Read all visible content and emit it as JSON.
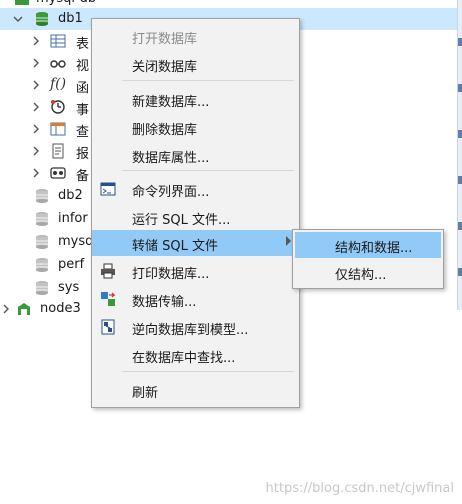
{
  "tree": {
    "top_label": "mysql-db",
    "db1": "db1",
    "children": [
      "表",
      "视",
      "函",
      "事",
      "查",
      "报",
      "备"
    ],
    "siblings": [
      "db2",
      "infor",
      "mysq",
      "perf",
      "sys"
    ],
    "node3": "node3"
  },
  "menu": {
    "items": {
      "open_db": "打开数据库",
      "close_db": "关闭数据库",
      "new_db": "新建数据库...",
      "delete_db": "删除数据库",
      "db_props": "数据库属性...",
      "cmd_console": "命令列界面...",
      "run_sql": "运行 SQL 文件...",
      "dump_sql": "转储 SQL 文件",
      "print_db": "打印数据库...",
      "data_transfer": "数据传输...",
      "reverse_model": "逆向数据库到模型...",
      "find_in_db": "在数据库中查找...",
      "refresh": "刷新"
    }
  },
  "submenu": {
    "structure_and_data": "结构和数据...",
    "structure_only": "仅结构..."
  },
  "watermark": "https://blog.csdn.net/cjwfinal",
  "colors": {
    "selection": "#cce8ff",
    "menu_highlight": "#91c9f7",
    "db_icon_green": "#3a9a3a",
    "db_icon_gray": "#b8b8b8"
  }
}
